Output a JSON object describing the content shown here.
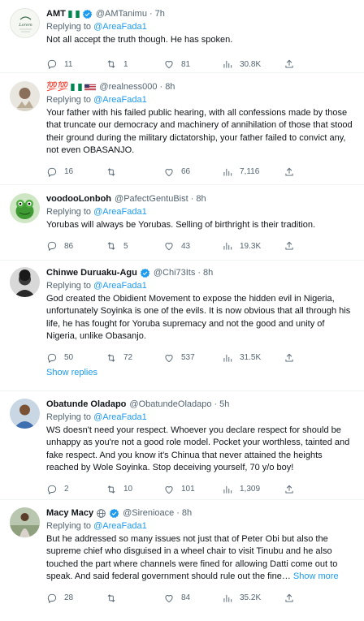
{
  "tweets": [
    {
      "display_name": "AMT",
      "handle": "@AMTanimu",
      "time": "7h",
      "flags": [
        "nigeria-flag"
      ],
      "verified": true,
      "reply_prefix": "Replying to",
      "reply_to": "@AreaFada1",
      "text": "Not all accept the truth though. He has spoken.",
      "replies": "11",
      "retweets": "1",
      "likes": "81",
      "views": "30.8K"
    },
    {
      "display_name": "💯💯",
      "handle": "@realness000",
      "time": "8h",
      "flags": [
        "nigeria-flag",
        "usa-flag"
      ],
      "verified": false,
      "reply_prefix": "Replying to",
      "reply_to": "@AreaFada1",
      "text": "Your father with his failed public hearing, with all confessions made by those that truncate our democracy and machinery of annihilation of those that stood their ground during the military dictatorship, your father failed to convict any, not even OBASANJO.",
      "replies": "16",
      "retweets": "",
      "likes": "66",
      "views": "7,116"
    },
    {
      "display_name": "voodooLonboh",
      "handle": "@PafectGentuBist",
      "time": "8h",
      "verified": false,
      "reply_prefix": "Replying to",
      "reply_to": "@AreaFada1",
      "text": "Yorubas will always be Yorubas. Selling of birthright is their tradition.",
      "replies": "86",
      "retweets": "5",
      "likes": "43",
      "views": "19.3K"
    },
    {
      "display_name": "Chinwe Duruaku-Agu",
      "handle": "@Chi73Its",
      "time": "8h",
      "verified": true,
      "reply_prefix": "Replying to",
      "reply_to": "@AreaFada1",
      "text": "God created the Obidient Movement to expose the hidden evil in Nigeria, unfortunately Soyinka is one of the evils. It is now obvious that all through his life, he has fought for Yoruba supremacy and not the good and unity of Nigeria, unlike Obasanjo.",
      "replies": "50",
      "retweets": "72",
      "likes": "537",
      "views": "31.5K",
      "show_replies": "Show replies"
    },
    {
      "display_name": "Obatunde Oladapo",
      "handle": "@ObatundeOladapo",
      "time": "5h",
      "verified": false,
      "reply_prefix": "Replying to",
      "reply_to": "@AreaFada1",
      "text": "WS doesn't need your respect. Whoever you declare respect for should be unhappy as you're not a good role model. Pocket your worthless, tainted and fake respect. And you know it's Chinua that never attained the heights reached by Wole Soyinka. Stop deceiving yourself, 70 y/o boy!",
      "replies": "2",
      "retweets": "10",
      "likes": "101",
      "views": "1,309"
    },
    {
      "display_name": "Macy Macy",
      "handle": "@Sirenioace",
      "time": "8h",
      "verified": true,
      "globe": true,
      "reply_prefix": "Replying to",
      "reply_to": "@AreaFada1",
      "text": "But he addressed so many issues not just that of Peter Obi but also the supreme chief who disguised in a wheel chair to visit Tinubu and he also touched the part where channels were fined for allowing Datti come out to speak. And said federal government should rule out the fine…",
      "show_more": "Show more",
      "replies": "28",
      "retweets": "",
      "likes": "84",
      "views": "35.2K"
    }
  ],
  "colors": {
    "accent": "#1d9bf0",
    "secondary_text": "#536471",
    "divider": "#eff3f4"
  },
  "icons": [
    "reply-icon",
    "retweet-icon",
    "like-icon",
    "views-icon",
    "share-icon",
    "verified-icon"
  ]
}
